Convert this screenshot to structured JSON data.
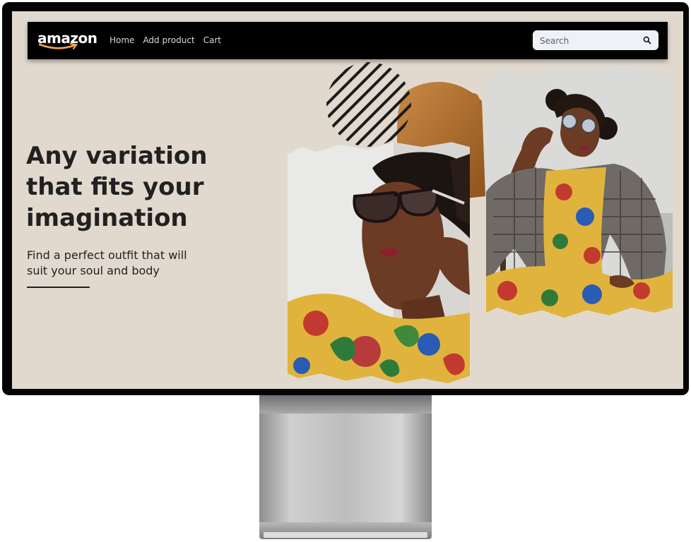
{
  "navbar": {
    "logo_text": "amazon",
    "links": [
      "Home",
      "Add product",
      "Cart"
    ],
    "search": {
      "placeholder": "Search",
      "value": ""
    }
  },
  "hero": {
    "title": "Any variation that fits your imagination",
    "subtitle": "Find a perfect outfit that will suit your soul and body"
  },
  "icons": {
    "search": "search-icon",
    "logo": "amazon-logo",
    "model_photo_1": "person-photo",
    "model_photo_2": "person-photo"
  },
  "colors": {
    "screen_background": "#e1d9ce",
    "navbar_background": "#000000",
    "text": "#212121",
    "accent_orange": "#b8732a"
  }
}
